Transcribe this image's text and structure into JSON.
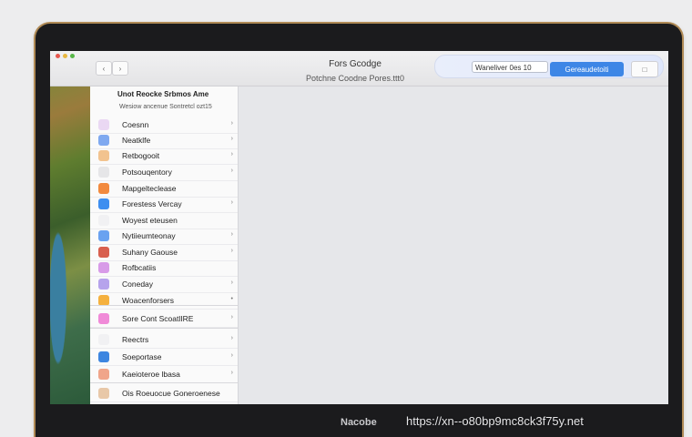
{
  "window": {
    "title": "Fors Gcodge",
    "subtitle": "Potchne Coodne Pores.ttt0"
  },
  "toolbar": {
    "back_label": "‹",
    "forward_label": "›",
    "search_value": "Waneliver 0es 10",
    "search_arrow": "◂",
    "primary_button_label": "Gereaudetoiti",
    "close_label": "□"
  },
  "sidebar": {
    "header": "Unot Reocke Srbmos Ame",
    "subheader": "Wesiow ancenue Sontretcl ozt15",
    "items": [
      {
        "label": "Coesnn",
        "icon": "#ead8f3",
        "chevron": "›"
      },
      {
        "label": "Neatklfe",
        "icon": "#7fa9f0",
        "chevron": "›"
      },
      {
        "label": "Retbogooit",
        "icon": "#f2c38f",
        "chevron": "›"
      },
      {
        "label": "Potsouqentory",
        "icon": "#e6e6e8",
        "chevron": "›"
      },
      {
        "label": "Mapgelteclease",
        "icon": "#f28a3e",
        "chevron": ""
      },
      {
        "label": "Forestess Vercay",
        "icon": "#3d8ef0",
        "chevron": "›"
      },
      {
        "label": "Woyest eteusen",
        "icon": "#f1f1f3",
        "chevron": ""
      },
      {
        "label": "Nytiieumteonay",
        "icon": "#6aa2f0",
        "chevron": "›"
      },
      {
        "label": "Suhany Gaouse",
        "icon": "#d85f4e",
        "chevron": "›"
      },
      {
        "label": "Rofbcatiis",
        "icon": "#d89be8",
        "chevron": ""
      },
      {
        "label": "Coneday",
        "icon": "#b6a3ec",
        "chevron": "›"
      },
      {
        "label": "Woacenforsers",
        "icon": "#f5b13f",
        "chevron": "•"
      },
      {
        "label": "Sore Cont ScoatlIRE",
        "icon": "#f08ad8",
        "chevron": "›"
      },
      {
        "label": "Reectrs",
        "icon": "#f1f1f3",
        "chevron": "›"
      },
      {
        "label": "Soeportase",
        "icon": "#3d86e0",
        "chevron": "›"
      },
      {
        "label": "Kaeioteroe lbasa",
        "icon": "#f0a58a",
        "chevron": "›"
      },
      {
        "label": "Ois Roeuocue Goneroenese",
        "icon": "#e8c8a8",
        "chevron": ""
      }
    ]
  },
  "device": {
    "brand": "Nacobe"
  },
  "watermark": "https://xn--o80bp9mc8ck3f75y.net"
}
